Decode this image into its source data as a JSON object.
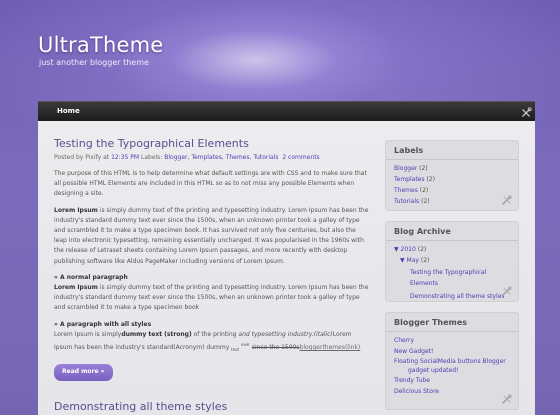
{
  "header": {
    "title": "UltraTheme",
    "description": "just another blogger theme"
  },
  "nav": {
    "home_label": "Home"
  },
  "post": {
    "title": "Testing the Typographical Elements",
    "meta_prefix": "Posted by",
    "author": "Pixify",
    "meta_at": "at",
    "time": "12:35 PM",
    "labels_prefix": "Labels:",
    "labels": [
      "Blogger,",
      "Templates,",
      "Themes,",
      "Tutorials"
    ],
    "comments": "2 comments",
    "intro": "The purpose of this HTML is to help determine what default settings are with CSS and to make sure that all possible HTML Elements are included in this HTML so as to not miss any possible Elements when designing a site.",
    "lorem_bold": "Lorem Ipsum",
    "lorem_text": "is simply dummy text of the printing and typesetting industry. Lorem Ipsum has been the industry's standard dummy text ever since the 1500s, when an unknown printer took a galley of type and scrambled it to make a type specimen book. It has survived not only five centuries, but also the leap into electronic typesetting, remaining essentially unchanged. It was popularised in the 1960s with the release of Letraset sheets containing Lorem Ipsum passages, and more recently with desktop publishing software like Aldus PageMaker including versions of Lorem Ipsum.",
    "normal_heading": "» A normal paragraph",
    "normal_text": "is simply dummy text of the printing and typesetting industry. Lorem Ipsum has been the industry's standard dummy text ever since the 1500s, when an unknown printer took a galley of type and scrambled it to make a type specimen book",
    "styles_heading": "» A paragraph with all styles",
    "styles_a": "Lorem Ipsum is simply",
    "styles_strong": "dummy text (strong)",
    "styles_b": "of the printing",
    "styles_italic": "and typesetting industry.(italic)",
    "styles_c": "Lorem Ipsum has been the industry's standard(Acronym) dummy",
    "styles_sub": "text",
    "styles_sup": "ever",
    "styles_strike": "since the 1500s",
    "styles_link": "bloggerthemes(link)",
    "read_more": "Read more »"
  },
  "post2": {
    "title": "Demonstrating all theme styles"
  },
  "sidebar": {
    "labels": {
      "title": "Labels",
      "items": [
        {
          "name": "Blogger",
          "count": "(2)"
        },
        {
          "name": "Templates",
          "count": "(2)"
        },
        {
          "name": "Themes",
          "count": "(2)"
        },
        {
          "name": "Tutorials",
          "count": "(2)"
        }
      ]
    },
    "archive": {
      "title": "Blog Archive",
      "year_toggle": "▼",
      "year": "2010",
      "year_count": "(2)",
      "month_toggle": "▼",
      "month": "May",
      "month_count": "(2)",
      "posts": [
        "Testing the Typographical Elements",
        "Demonstrating all theme styles"
      ]
    },
    "themes": {
      "title": "Blogger Themes",
      "items": [
        "Cherry",
        "New Gadget!",
        "Floating SocialMedia buttons Blogger",
        "gadget updated!",
        "Trendy Tube",
        "Delicious Store"
      ]
    }
  },
  "colors": {
    "background": "#7a66b4",
    "accent": "#5b4d8f",
    "link": "#4d3fb3",
    "button": "#8a70cc"
  }
}
